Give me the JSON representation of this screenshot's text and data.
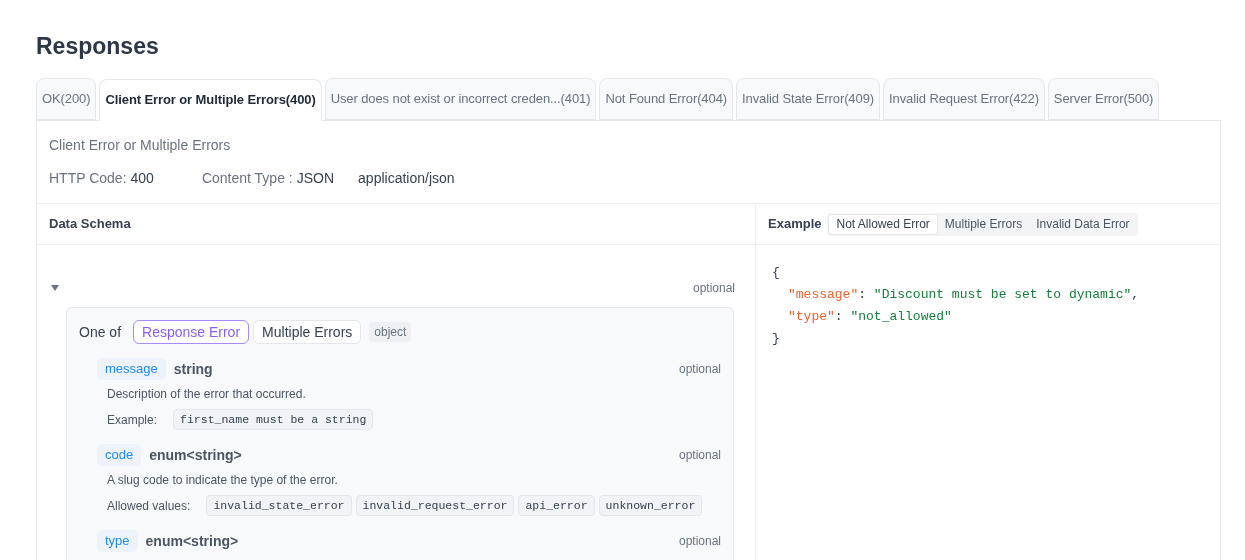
{
  "title": "Responses",
  "tabs": [
    {
      "label": "OK(200)",
      "selected": false
    },
    {
      "label": "Client Error or Multiple Errors(400)",
      "selected": true
    },
    {
      "label": "User does not exist or incorrect creden...(401)",
      "selected": false
    },
    {
      "label": "Not Found Error(404)",
      "selected": false
    },
    {
      "label": "Invalid State Error(409)",
      "selected": false
    },
    {
      "label": "Invalid Request Error(422)",
      "selected": false
    },
    {
      "label": "Server Error(500)",
      "selected": false
    }
  ],
  "response": {
    "name": "Client Error or Multiple Errors",
    "http_code_label": "HTTP Code:",
    "http_code": "400",
    "content_type_label": "Content Type :",
    "content_type": "JSON",
    "mime": "application/json"
  },
  "schema": {
    "header": "Data Schema",
    "expanded": true,
    "root_optional": "optional",
    "one_of_label": "One of",
    "variants": [
      {
        "label": "Response Error",
        "selected": true
      },
      {
        "label": "Multiple Errors",
        "selected": false
      }
    ],
    "type_badge": "object",
    "fields": [
      {
        "name": "message",
        "type": "string",
        "optional": "optional",
        "description": "Description of the error that occurred.",
        "example_label": "Example:",
        "example": "first_name must be a string"
      },
      {
        "name": "code",
        "type": "enum<string>",
        "optional": "optional",
        "description": "A slug code to indicate the type of the error.",
        "allowed_label": "Allowed values:",
        "allowed": [
          "invalid_state_error",
          "invalid_request_error",
          "api_error",
          "unknown_error"
        ]
      },
      {
        "name": "type",
        "type": "enum<string>",
        "optional": "optional"
      }
    ]
  },
  "example": {
    "header": "Example",
    "tabs": [
      {
        "label": "Not Allowed Error",
        "selected": true
      },
      {
        "label": "Multiple Errors",
        "selected": false
      },
      {
        "label": "Invalid Data Error",
        "selected": false
      }
    ],
    "code_lines": [
      [
        {
          "kind": "punct",
          "text": "{"
        }
      ],
      [
        {
          "kind": "key",
          "text": "\"message\""
        },
        {
          "kind": "punct",
          "text": ":"
        },
        {
          "kind": "string",
          "text": "\"Discount must be set to dynamic\""
        },
        {
          "kind": "punct",
          "text": ","
        }
      ],
      [
        {
          "kind": "key",
          "text": "\"type\""
        },
        {
          "kind": "punct",
          "text": ":"
        },
        {
          "kind": "string",
          "text": "\"not_allowed\""
        }
      ],
      [
        {
          "kind": "punct",
          "text": "}"
        }
      ]
    ]
  }
}
